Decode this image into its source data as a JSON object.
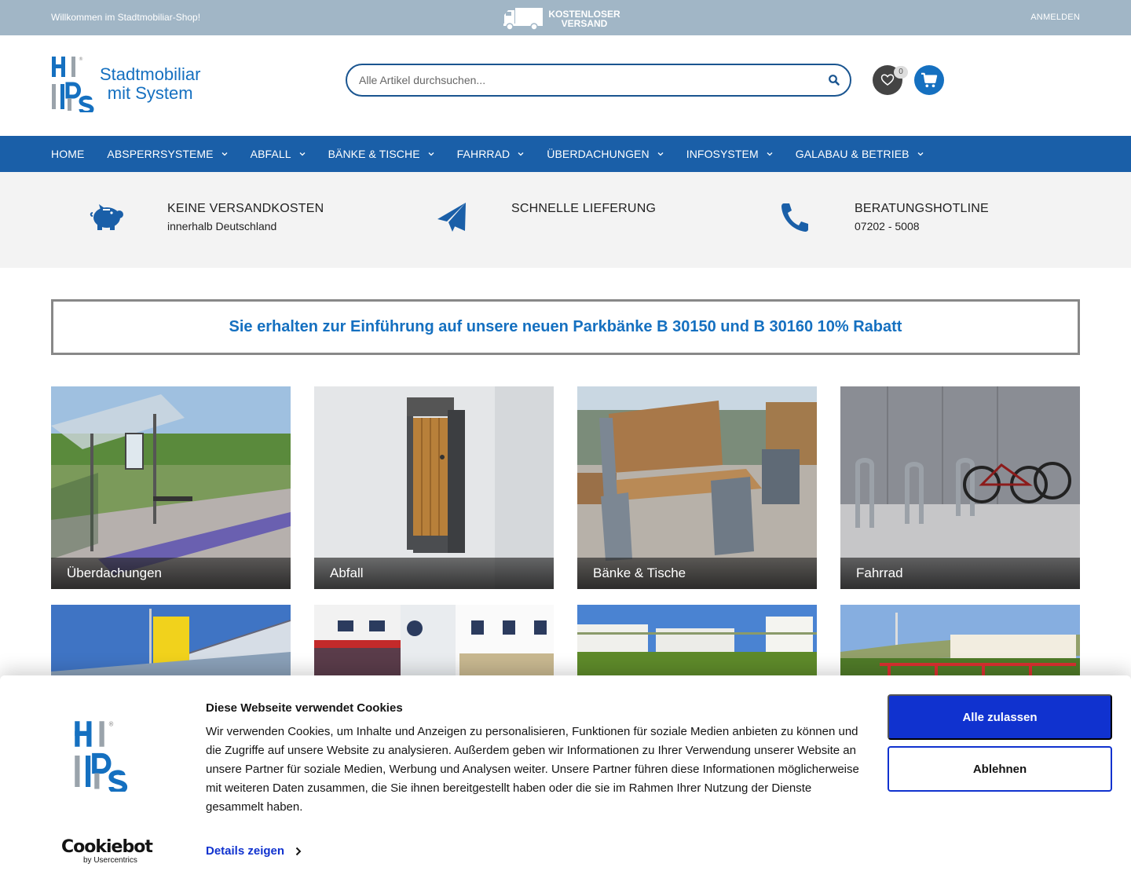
{
  "topbar": {
    "welcome": "Willkommen im Stadtmobiliar-Shop!",
    "shipping_line1": "KOSTENLOSER",
    "shipping_line2": "VERSAND",
    "login": "ANMELDEN"
  },
  "header": {
    "logo_line1": "Stadtmobiliar",
    "logo_line2": "mit System",
    "search_placeholder": "Alle Artikel durchsuchen...",
    "wishlist_count": "0"
  },
  "nav": {
    "items": [
      {
        "label": "HOME",
        "has_dropdown": false
      },
      {
        "label": "ABSPERRSYSTEME",
        "has_dropdown": true
      },
      {
        "label": "ABFALL",
        "has_dropdown": true
      },
      {
        "label": "BÄNKE & TISCHE",
        "has_dropdown": true
      },
      {
        "label": "FAHRRAD",
        "has_dropdown": true
      },
      {
        "label": "ÜBERDACHUNGEN",
        "has_dropdown": true
      },
      {
        "label": "INFOSYSTEM",
        "has_dropdown": true
      },
      {
        "label": "GALABAU & BETRIEB",
        "has_dropdown": true
      }
    ]
  },
  "usp": [
    {
      "icon": "piggy-bank-icon",
      "title": "KEINE VERSANDKOSTEN",
      "sub": "innerhalb Deutschland"
    },
    {
      "icon": "paper-plane-icon",
      "title": "SCHNELLE LIEFERUNG",
      "sub": ""
    },
    {
      "icon": "phone-icon",
      "title": "BERATUNGSHOTLINE",
      "sub": "07202 - 5008"
    }
  ],
  "promo": {
    "text": "Sie erhalten zur Einführung auf unsere neuen Parkbänke B 30150 und B 30160 10% Rabatt"
  },
  "tiles": [
    {
      "label": "Überdachungen"
    },
    {
      "label": "Abfall"
    },
    {
      "label": "Bänke & Tische"
    },
    {
      "label": "Fahrrad"
    },
    {
      "label": ""
    },
    {
      "label": ""
    },
    {
      "label": ""
    },
    {
      "label": ""
    }
  ],
  "cookie": {
    "title": "Diese Webseite verwendet Cookies",
    "body": "Wir verwenden Cookies, um Inhalte und Anzeigen zu personalisieren, Funktionen für soziale Medien anbieten zu können und die Zugriffe auf unsere Website zu analysieren. Außerdem geben wir Informationen zu Ihrer Verwendung unserer Website an unsere Partner für soziale Medien, Werbung und Analysen weiter. Unsere Partner führen diese Informationen möglicherweise mit weiteren Daten zusammen, die Sie ihnen bereitgestellt haben oder die sie im Rahmen Ihrer Nutzung der Dienste gesammelt haben.",
    "details": "Details zeigen",
    "accept": "Alle zulassen",
    "decline": "Ablehnen",
    "provider": "Cookiebot",
    "provider_sub": "by Usercentrics"
  },
  "colors": {
    "topbar": "#a1b6c6",
    "nav": "#1a5fa8",
    "brand_blue": "#1570c0",
    "cookie_blue": "#1032cf"
  }
}
